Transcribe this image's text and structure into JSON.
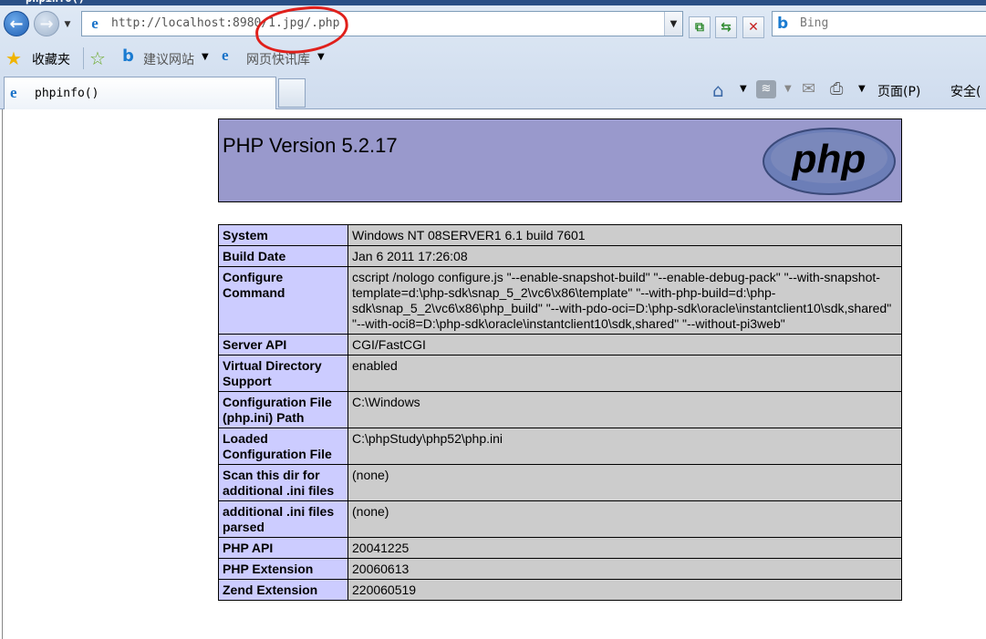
{
  "browser": {
    "url": "http://localhost:8980/1.jpg/.php",
    "search_placeholder": "Bing",
    "favorites_label": "收藏夹",
    "suggested_sites_label": "建议网站",
    "web_slice_label": "网页快讯库",
    "tab_title": "phpinfo()",
    "page_menu_label": "页面(P)",
    "safety_menu_label": "安全("
  },
  "colors": {
    "php_header": "#9999cc",
    "label_cell": "#ccccff",
    "value_cell": "#cccccc",
    "annotation": "#e0201b"
  },
  "phpinfo": {
    "version_title": "PHP Version 5.2.17",
    "logo_text": "php",
    "rows": [
      {
        "label": "System",
        "value": "Windows NT 08SERVER1 6.1 build 7601"
      },
      {
        "label": "Build Date",
        "value": "Jan 6 2011 17:26:08"
      },
      {
        "label": "Configure Command",
        "value": "cscript /nologo configure.js \"--enable-snapshot-build\" \"--enable-debug-pack\" \"--with-snapshot-template=d:\\php-sdk\\snap_5_2\\vc6\\x86\\template\" \"--with-php-build=d:\\php-sdk\\snap_5_2\\vc6\\x86\\php_build\" \"--with-pdo-oci=D:\\php-sdk\\oracle\\instantclient10\\sdk,shared\" \"--with-oci8=D:\\php-sdk\\oracle\\instantclient10\\sdk,shared\" \"--without-pi3web\""
      },
      {
        "label": "Server API",
        "value": "CGI/FastCGI"
      },
      {
        "label": "Virtual Directory Support",
        "value": "enabled"
      },
      {
        "label": "Configuration File (php.ini) Path",
        "value": "C:\\Windows"
      },
      {
        "label": "Loaded Configuration File",
        "value": "C:\\phpStudy\\php52\\php.ini"
      },
      {
        "label": "Scan this dir for additional .ini files",
        "value": "(none)"
      },
      {
        "label": "additional .ini files parsed",
        "value": "(none)"
      },
      {
        "label": "PHP API",
        "value": "20041225"
      },
      {
        "label": "PHP Extension",
        "value": "20060613"
      },
      {
        "label": "Zend Extension",
        "value": "220060519"
      }
    ]
  }
}
